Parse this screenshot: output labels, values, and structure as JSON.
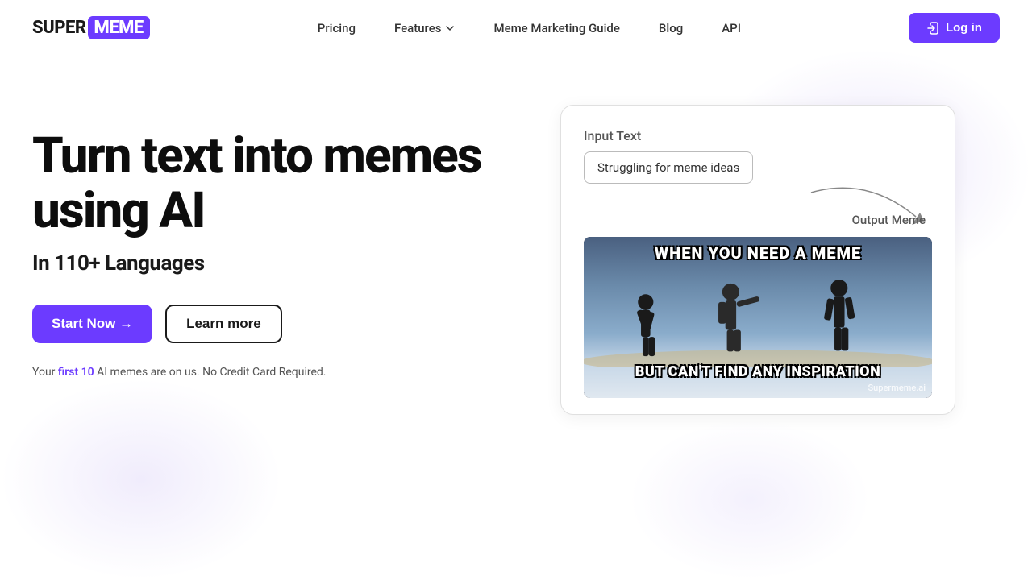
{
  "brand": {
    "super": "SUPER",
    "meme": "MEME",
    "logo_box_color": "#6c3bff"
  },
  "nav": {
    "pricing_label": "Pricing",
    "features_label": "Features",
    "meme_guide_label": "Meme Marketing Guide",
    "blog_label": "Blog",
    "api_label": "API",
    "login_label": "Log in"
  },
  "hero": {
    "title": "Turn text into memes using AI",
    "subtitle": "In 110+ Languages",
    "start_btn": "Start Now →",
    "learn_btn": "Learn more",
    "note_prefix": "Your ",
    "note_highlight": "first 10",
    "note_suffix": " AI memes are on us. No Credit Card Required."
  },
  "demo": {
    "input_label": "Input Text",
    "input_value": "Struggling for meme ideas",
    "output_label": "Output Meme",
    "meme_top_text": "WHEN YOU NEED A MEME",
    "meme_bottom_text": "BUT CAN'T FIND ANY INSPIRATION",
    "meme_watermark": "Supermeme.ai"
  }
}
